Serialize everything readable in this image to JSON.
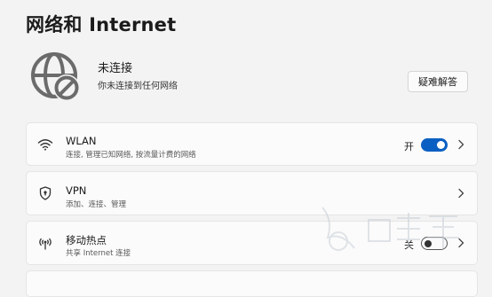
{
  "page": {
    "title": "网络和 Internet"
  },
  "status": {
    "title": "未连接",
    "subtitle": "你未连接到任何网络",
    "troubleshoot_label": "疑难解答",
    "icon": "globe-disconnected-icon"
  },
  "items": [
    {
      "icon": "wifi-icon",
      "title": "WLAN",
      "desc": "连接, 管理已知网络, 按流量计费的网络",
      "toggle_label": "开",
      "toggle_on": true
    },
    {
      "icon": "vpn-shield-icon",
      "title": "VPN",
      "desc": "添加、连接、管理"
    },
    {
      "icon": "hotspot-icon",
      "title": "移动热点",
      "desc": "共享 Internet 连接",
      "toggle_label": "关",
      "toggle_on": false
    }
  ],
  "colors": {
    "accent": "#0a5fc2",
    "background": "#f3f3f3",
    "card": "#fbfbfb"
  }
}
